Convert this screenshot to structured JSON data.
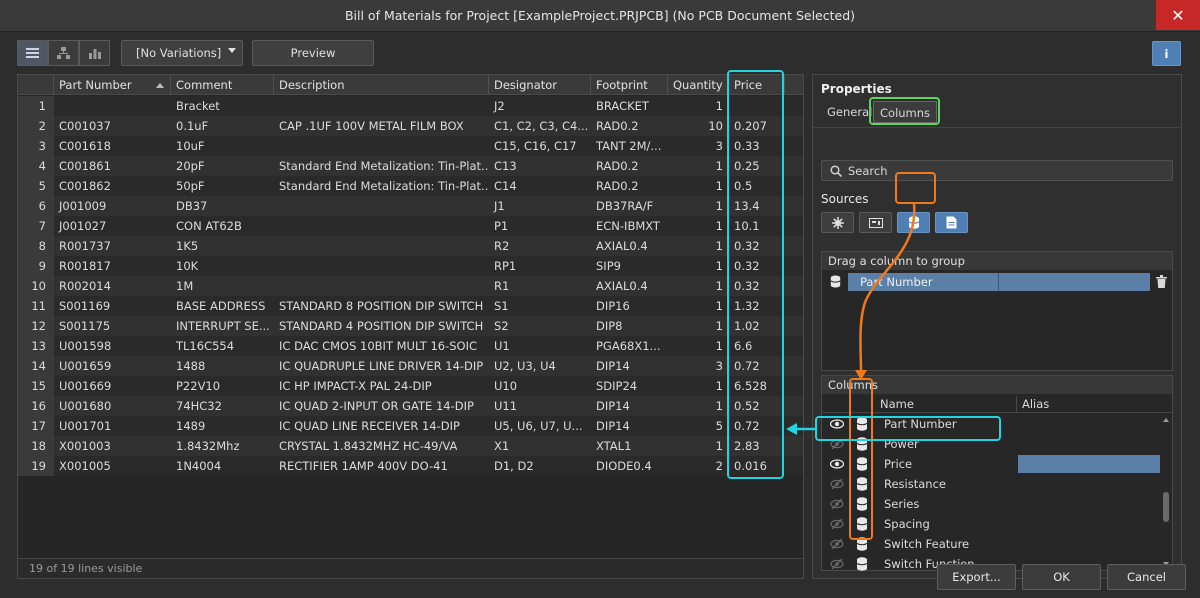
{
  "window": {
    "title": "Bill of Materials for Project [ExampleProject.PRJPCB] (No PCB Document Selected)",
    "close_icon": "close-icon"
  },
  "toolbar": {
    "variations_label": "[No Variations]",
    "preview_label": "Preview",
    "info_label": "i"
  },
  "table": {
    "headers": [
      "Part Number",
      "Comment",
      "Description",
      "Designator",
      "Footprint",
      "Quantity",
      "Price"
    ],
    "rows": [
      [
        "1",
        "",
        "Bracket",
        "",
        "J2",
        "BRACKET",
        "1",
        ""
      ],
      [
        "2",
        "C001037",
        "0.1uF",
        "CAP .1UF 100V METAL FILM BOX",
        "C1, C2, C3, C4...",
        "RAD0.2",
        "10",
        "0.207"
      ],
      [
        "3",
        "C001618",
        "10uF",
        "",
        "C15, C16, C17",
        "TANT 2M/...",
        "3",
        "0.33"
      ],
      [
        "4",
        "C001861",
        "20pF",
        "Standard End Metalization: Tin-Plat...",
        "C13",
        "RAD0.2",
        "1",
        "0.25"
      ],
      [
        "5",
        "C001862",
        "50pF",
        "Standard End Metalization: Tin-Plat...",
        "C14",
        "RAD0.2",
        "1",
        "0.5"
      ],
      [
        "6",
        "J001009",
        "DB37",
        "",
        "J1",
        "DB37RA/F",
        "1",
        "13.4"
      ],
      [
        "7",
        "J001027",
        "CON AT62B",
        "",
        "P1",
        "ECN-IBMXT",
        "1",
        "10.1"
      ],
      [
        "8",
        "R001737",
        "1K5",
        "",
        "R2",
        "AXIAL0.4",
        "1",
        "0.32"
      ],
      [
        "9",
        "R001817",
        "10K",
        "",
        "RP1",
        "SIP9",
        "1",
        "0.32"
      ],
      [
        "10",
        "R002014",
        "1M",
        "",
        "R1",
        "AXIAL0.4",
        "1",
        "0.32"
      ],
      [
        "11",
        "S001169",
        "BASE ADDRESS",
        "STANDARD 8 POSITION DIP SWITCH",
        "S1",
        "DIP16",
        "1",
        "1.32"
      ],
      [
        "12",
        "S001175",
        "INTERRUPT SE...",
        "STANDARD 4 POSITION DIP SWITCH",
        "S2",
        "DIP8",
        "1",
        "1.02"
      ],
      [
        "13",
        "U001598",
        "TL16C554",
        "IC DAC CMOS 10BIT MULT 16-SOIC",
        "U1",
        "PGA68X1...",
        "1",
        "6.6"
      ],
      [
        "14",
        "U001659",
        "1488",
        "IC QUADRUPLE LINE DRIVER 14-DIP",
        "U2, U3, U4",
        "DIP14",
        "3",
        "0.72"
      ],
      [
        "15",
        "U001669",
        "P22V10",
        "IC HP IMPACT-X PAL 24-DIP",
        "U10",
        "SDIP24",
        "1",
        "6.528"
      ],
      [
        "16",
        "U001680",
        "74HC32",
        "IC QUAD 2-INPUT OR GATE 14-DIP",
        "U11",
        "DIP14",
        "1",
        "0.52"
      ],
      [
        "17",
        "U001701",
        "1489",
        "IC QUAD LINE RECEIVER 14-DIP",
        "U5, U6, U7, U...",
        "DIP14",
        "5",
        "0.72"
      ],
      [
        "18",
        "X001003",
        "1.8432Mhz",
        "CRYSTAL 1.8432MHZ HC-49/VA",
        "X1",
        "XTAL1",
        "1",
        "2.83"
      ],
      [
        "19",
        "X001005",
        "1N4004",
        "RECTIFIER 1AMP 400V DO-41",
        "D1, D2",
        "DIODE0.4",
        "2",
        "0.016"
      ]
    ],
    "status": "19 of 19 lines visible"
  },
  "properties": {
    "title": "Properties",
    "tabs": [
      "General",
      "Columns"
    ],
    "search_placeholder": "Search",
    "sources_label": "Sources",
    "group_header": "Drag a column to group",
    "group_item": "Part Number",
    "columns_header": "Columns",
    "columns_sub": {
      "name": "Name",
      "alias": "Alias"
    },
    "columns": [
      {
        "name": "Part Number",
        "visible": true
      },
      {
        "name": "Power",
        "visible": false
      },
      {
        "name": "Price",
        "visible": true
      },
      {
        "name": "Resistance",
        "visible": false
      },
      {
        "name": "Series",
        "visible": false
      },
      {
        "name": "Spacing",
        "visible": false
      },
      {
        "name": "Switch Feature",
        "visible": false
      },
      {
        "name": "Switch Function",
        "visible": false
      }
    ]
  },
  "footer": {
    "export_label": "Export...",
    "ok_label": "OK",
    "cancel_label": "Cancel"
  },
  "colors": {
    "accent_blue": "#4f7fb5",
    "highlight_cyan": "#22d3e0",
    "highlight_orange": "#f07a1a",
    "highlight_green": "#5fd35f"
  }
}
